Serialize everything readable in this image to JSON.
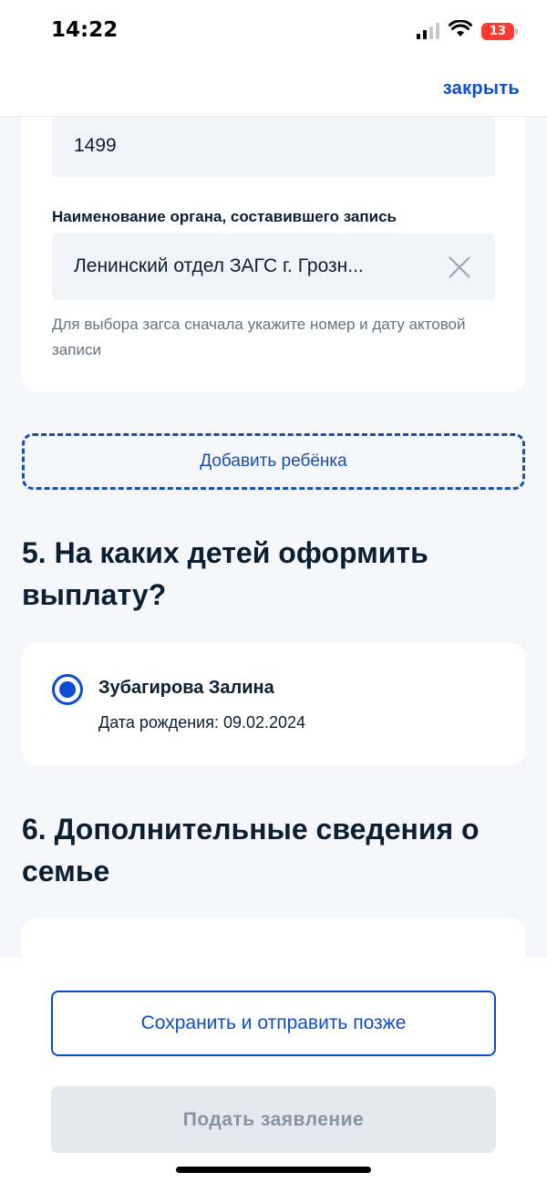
{
  "status_bar": {
    "time": "14:22",
    "battery": "13",
    "icons": [
      "signal-icon",
      "wifi-icon",
      "battery-charging-icon"
    ]
  },
  "header": {
    "close_label": "закрыть"
  },
  "act_record": {
    "number_value": "1499",
    "authority_label": "Наименование органа, составившего запись",
    "authority_value": "Ленинский отдел ЗАГС г. Грозн...",
    "hint": "Для выбора загса сначала укажите номер и дату актовой записи"
  },
  "add_child_label": "Добавить ребёнка",
  "section5": {
    "title": "5. На каких детей оформить выплату?",
    "child": {
      "name": "Зубагирова Залина",
      "birth_date": "Дата рождения: 09.02.2024",
      "selected": true
    }
  },
  "section6": {
    "title": "6. Дополнительные сведения о семье"
  },
  "actions": {
    "save_later": "Сохранить и отправить позже",
    "submit": "Подать заявление"
  },
  "colors": {
    "accent": "#0d4cd3",
    "page_bg": "#f5f7fb",
    "field_bg": "#f0f3f7",
    "disabled_bg": "#e4e9f0",
    "disabled_text": "#8793a1",
    "battery_low": "#ff3b30"
  }
}
